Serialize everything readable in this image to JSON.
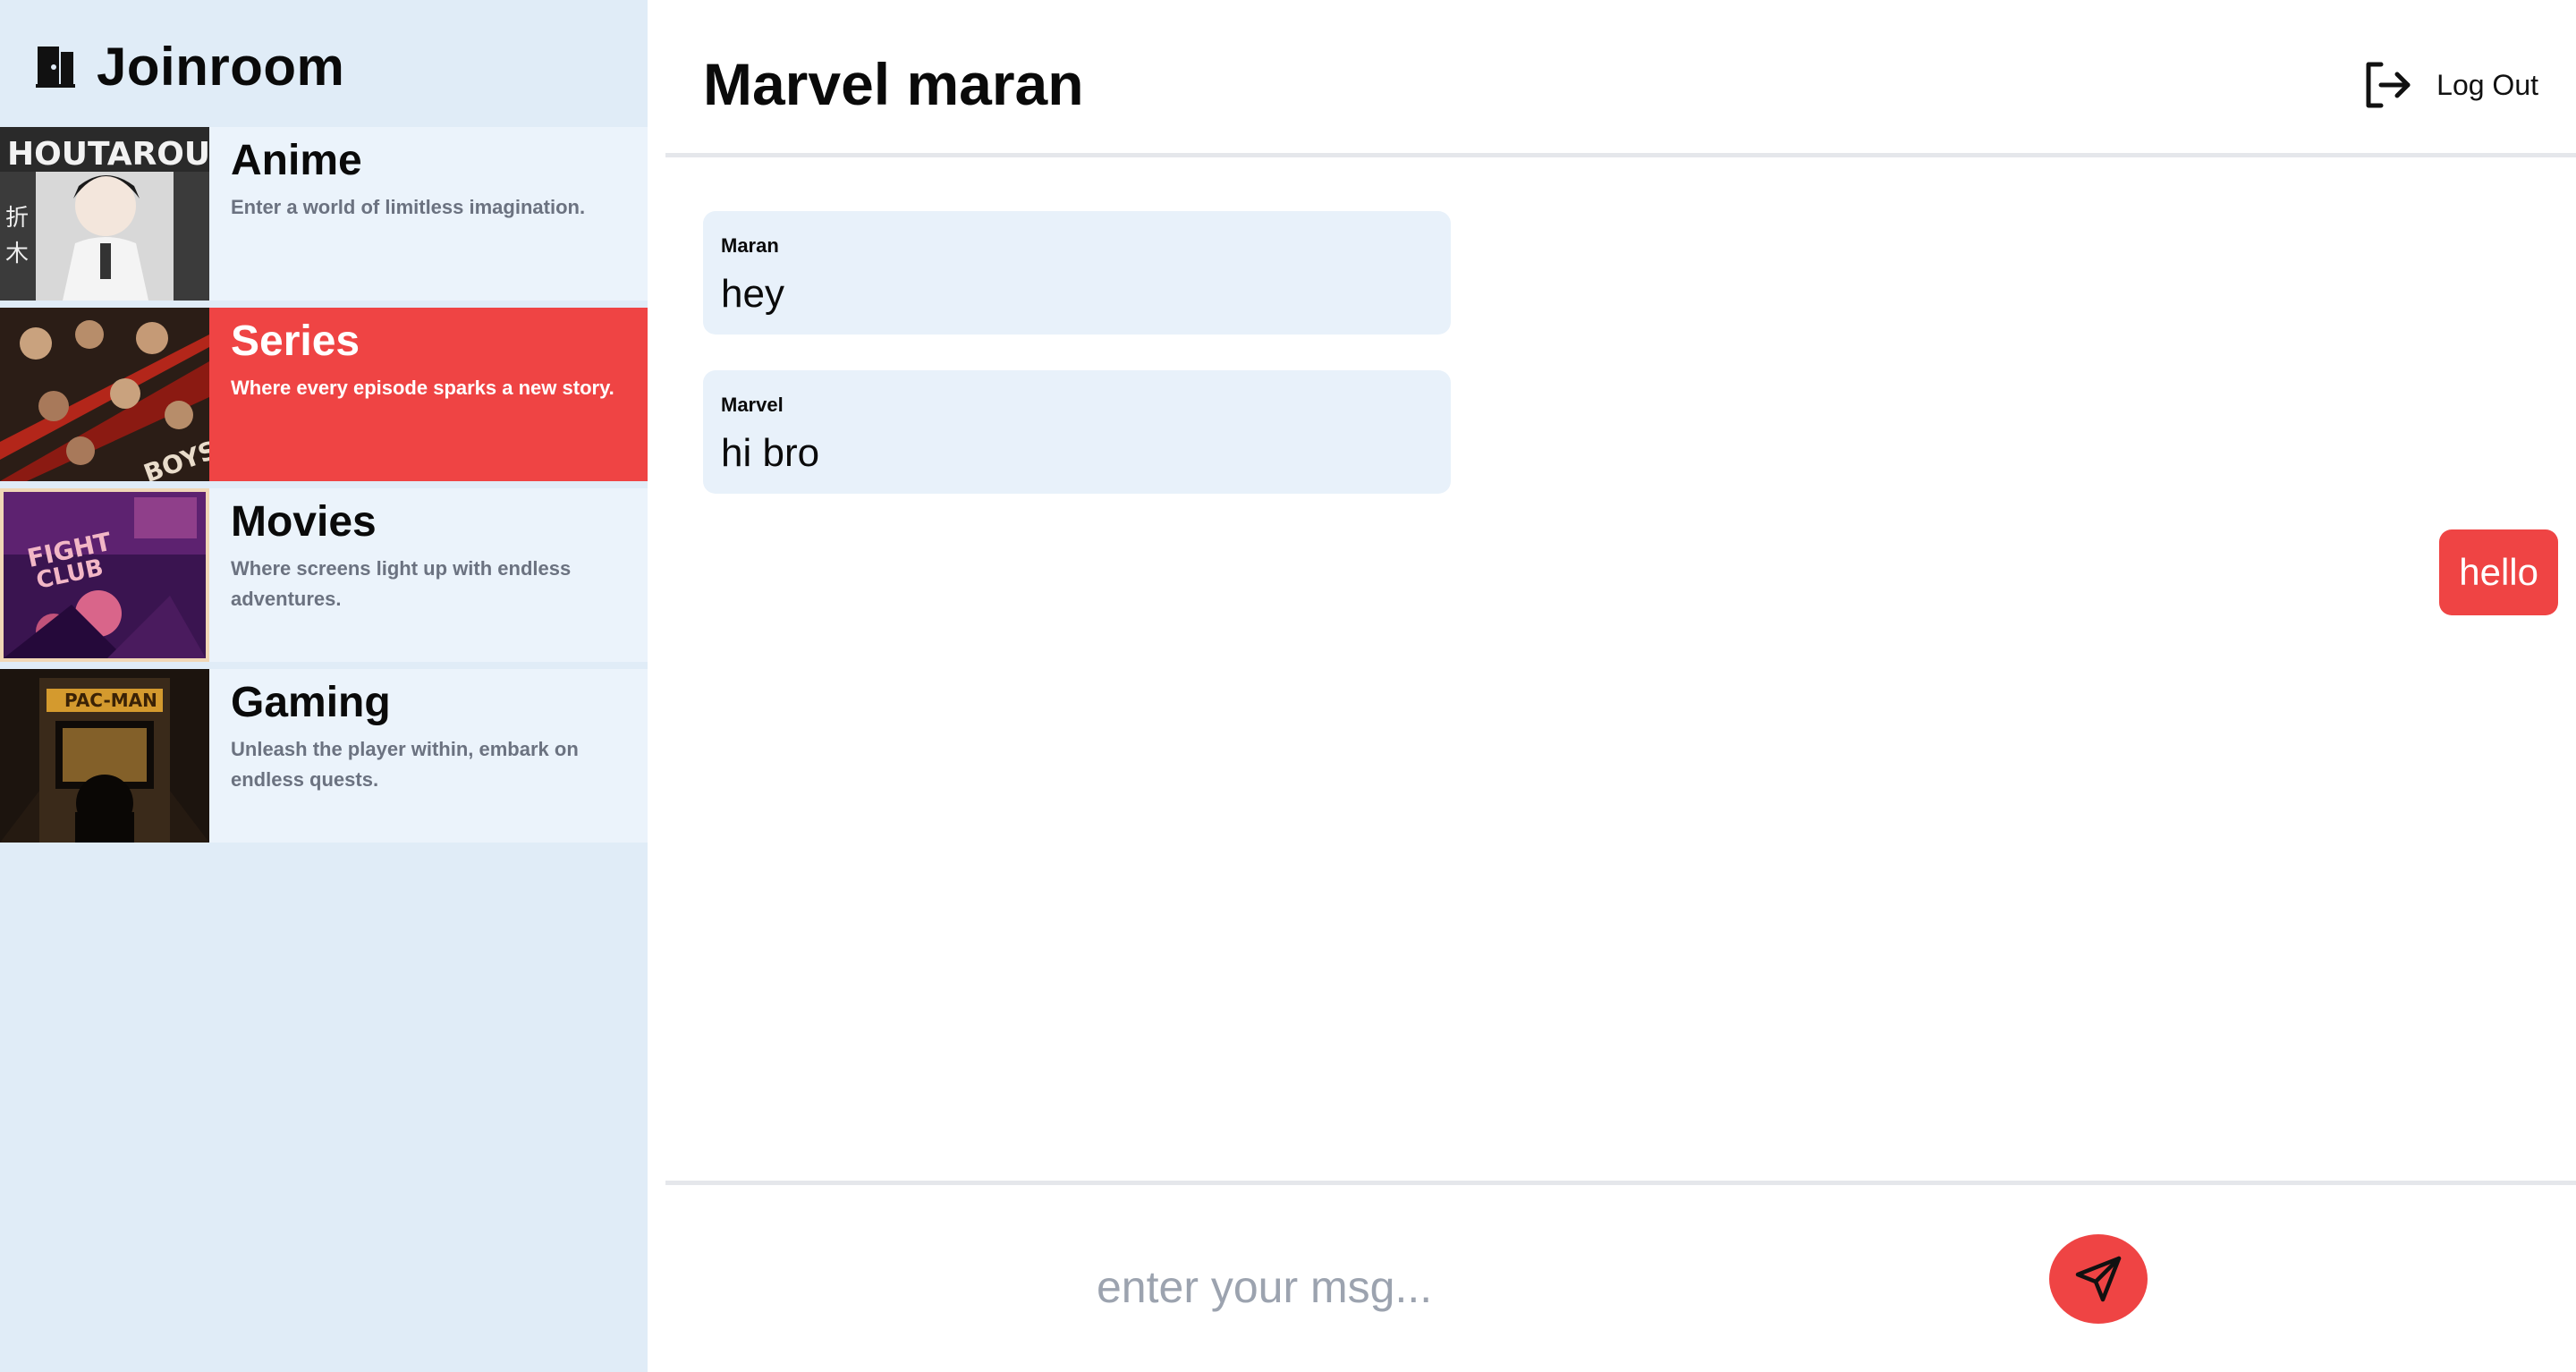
{
  "brand": {
    "title": "Joinroom",
    "icon": "door-icon"
  },
  "rooms": [
    {
      "title": "Anime",
      "description": "Enter a world of limitless imagination.",
      "active": false,
      "thumb": "anime-thumbnail"
    },
    {
      "title": "Series",
      "description": "Where every episode sparks a new story.",
      "active": true,
      "thumb": "series-thumbnail"
    },
    {
      "title": "Movies",
      "description": "Where screens light up with endless adventures.",
      "active": false,
      "thumb": "movies-thumbnail"
    },
    {
      "title": "Gaming",
      "description": "Unleash the player within, embark on endless quests.",
      "active": false,
      "thumb": "gaming-thumbnail"
    }
  ],
  "header": {
    "title": "Marvel maran",
    "logout_label": "Log Out",
    "logout_icon": "logout-icon"
  },
  "messages": [
    {
      "sender": "Maran",
      "text": "hey",
      "own": false
    },
    {
      "sender": "Marvel",
      "text": "hi bro",
      "own": false
    },
    {
      "sender": "",
      "text": "hello",
      "own": true
    }
  ],
  "composer": {
    "placeholder": "enter your msg...",
    "value": "",
    "send_icon": "send-icon"
  },
  "colors": {
    "accent": "#ef4444",
    "sidebar_bg": "#e0ecf7",
    "room_bg": "#ebf3fb",
    "incoming_bubble": "#e8f1fa",
    "divider": "#e5e7eb"
  }
}
